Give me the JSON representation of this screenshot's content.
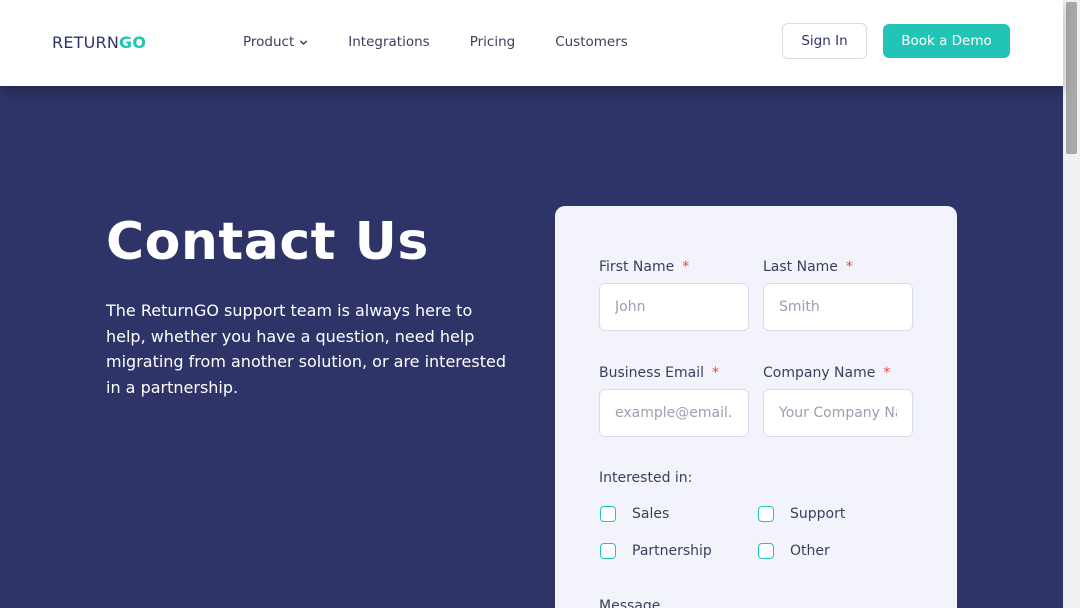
{
  "header": {
    "logo_return": "RETURN",
    "logo_go": "GO",
    "nav": [
      "Product",
      "Integrations",
      "Pricing",
      "Customers"
    ],
    "sign_in": "Sign In",
    "book_demo": "Book a Demo"
  },
  "hero": {
    "title": "Contact Us",
    "text": "The ReturnGO support team is always here to help, whether you have a question, need help migrating from another solution, or are interested in a partnership."
  },
  "form": {
    "first_name_label": "First Name",
    "first_name_placeholder": "John",
    "last_name_label": "Last Name",
    "last_name_placeholder": "Smith",
    "email_label": "Business Email",
    "email_placeholder": "example@email.com",
    "company_label": "Company Name",
    "company_placeholder": "Your Company Name",
    "required_mark": "*",
    "interested_label": "Interested in:",
    "options": [
      "Sales",
      "Support",
      "Partnership",
      "Other"
    ],
    "message_label": "Message"
  },
  "colors": {
    "accent": "#22c4b5",
    "navy": "#2f3468",
    "required": "#e04848"
  }
}
